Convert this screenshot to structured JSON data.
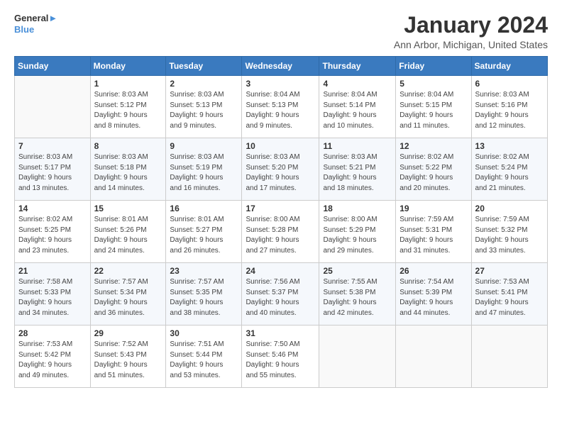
{
  "header": {
    "logo_line1": "General",
    "logo_line2": "Blue",
    "month_year": "January 2024",
    "location": "Ann Arbor, Michigan, United States"
  },
  "weekdays": [
    "Sunday",
    "Monday",
    "Tuesday",
    "Wednesday",
    "Thursday",
    "Friday",
    "Saturday"
  ],
  "weeks": [
    [
      {
        "num": "",
        "info": ""
      },
      {
        "num": "1",
        "info": "Sunrise: 8:03 AM\nSunset: 5:12 PM\nDaylight: 9 hours\nand 8 minutes."
      },
      {
        "num": "2",
        "info": "Sunrise: 8:03 AM\nSunset: 5:13 PM\nDaylight: 9 hours\nand 9 minutes."
      },
      {
        "num": "3",
        "info": "Sunrise: 8:04 AM\nSunset: 5:13 PM\nDaylight: 9 hours\nand 9 minutes."
      },
      {
        "num": "4",
        "info": "Sunrise: 8:04 AM\nSunset: 5:14 PM\nDaylight: 9 hours\nand 10 minutes."
      },
      {
        "num": "5",
        "info": "Sunrise: 8:04 AM\nSunset: 5:15 PM\nDaylight: 9 hours\nand 11 minutes."
      },
      {
        "num": "6",
        "info": "Sunrise: 8:03 AM\nSunset: 5:16 PM\nDaylight: 9 hours\nand 12 minutes."
      }
    ],
    [
      {
        "num": "7",
        "info": "Sunrise: 8:03 AM\nSunset: 5:17 PM\nDaylight: 9 hours\nand 13 minutes."
      },
      {
        "num": "8",
        "info": "Sunrise: 8:03 AM\nSunset: 5:18 PM\nDaylight: 9 hours\nand 14 minutes."
      },
      {
        "num": "9",
        "info": "Sunrise: 8:03 AM\nSunset: 5:19 PM\nDaylight: 9 hours\nand 16 minutes."
      },
      {
        "num": "10",
        "info": "Sunrise: 8:03 AM\nSunset: 5:20 PM\nDaylight: 9 hours\nand 17 minutes."
      },
      {
        "num": "11",
        "info": "Sunrise: 8:03 AM\nSunset: 5:21 PM\nDaylight: 9 hours\nand 18 minutes."
      },
      {
        "num": "12",
        "info": "Sunrise: 8:02 AM\nSunset: 5:22 PM\nDaylight: 9 hours\nand 20 minutes."
      },
      {
        "num": "13",
        "info": "Sunrise: 8:02 AM\nSunset: 5:24 PM\nDaylight: 9 hours\nand 21 minutes."
      }
    ],
    [
      {
        "num": "14",
        "info": "Sunrise: 8:02 AM\nSunset: 5:25 PM\nDaylight: 9 hours\nand 23 minutes."
      },
      {
        "num": "15",
        "info": "Sunrise: 8:01 AM\nSunset: 5:26 PM\nDaylight: 9 hours\nand 24 minutes."
      },
      {
        "num": "16",
        "info": "Sunrise: 8:01 AM\nSunset: 5:27 PM\nDaylight: 9 hours\nand 26 minutes."
      },
      {
        "num": "17",
        "info": "Sunrise: 8:00 AM\nSunset: 5:28 PM\nDaylight: 9 hours\nand 27 minutes."
      },
      {
        "num": "18",
        "info": "Sunrise: 8:00 AM\nSunset: 5:29 PM\nDaylight: 9 hours\nand 29 minutes."
      },
      {
        "num": "19",
        "info": "Sunrise: 7:59 AM\nSunset: 5:31 PM\nDaylight: 9 hours\nand 31 minutes."
      },
      {
        "num": "20",
        "info": "Sunrise: 7:59 AM\nSunset: 5:32 PM\nDaylight: 9 hours\nand 33 minutes."
      }
    ],
    [
      {
        "num": "21",
        "info": "Sunrise: 7:58 AM\nSunset: 5:33 PM\nDaylight: 9 hours\nand 34 minutes."
      },
      {
        "num": "22",
        "info": "Sunrise: 7:57 AM\nSunset: 5:34 PM\nDaylight: 9 hours\nand 36 minutes."
      },
      {
        "num": "23",
        "info": "Sunrise: 7:57 AM\nSunset: 5:35 PM\nDaylight: 9 hours\nand 38 minutes."
      },
      {
        "num": "24",
        "info": "Sunrise: 7:56 AM\nSunset: 5:37 PM\nDaylight: 9 hours\nand 40 minutes."
      },
      {
        "num": "25",
        "info": "Sunrise: 7:55 AM\nSunset: 5:38 PM\nDaylight: 9 hours\nand 42 minutes."
      },
      {
        "num": "26",
        "info": "Sunrise: 7:54 AM\nSunset: 5:39 PM\nDaylight: 9 hours\nand 44 minutes."
      },
      {
        "num": "27",
        "info": "Sunrise: 7:53 AM\nSunset: 5:41 PM\nDaylight: 9 hours\nand 47 minutes."
      }
    ],
    [
      {
        "num": "28",
        "info": "Sunrise: 7:53 AM\nSunset: 5:42 PM\nDaylight: 9 hours\nand 49 minutes."
      },
      {
        "num": "29",
        "info": "Sunrise: 7:52 AM\nSunset: 5:43 PM\nDaylight: 9 hours\nand 51 minutes."
      },
      {
        "num": "30",
        "info": "Sunrise: 7:51 AM\nSunset: 5:44 PM\nDaylight: 9 hours\nand 53 minutes."
      },
      {
        "num": "31",
        "info": "Sunrise: 7:50 AM\nSunset: 5:46 PM\nDaylight: 9 hours\nand 55 minutes."
      },
      {
        "num": "",
        "info": ""
      },
      {
        "num": "",
        "info": ""
      },
      {
        "num": "",
        "info": ""
      }
    ]
  ]
}
